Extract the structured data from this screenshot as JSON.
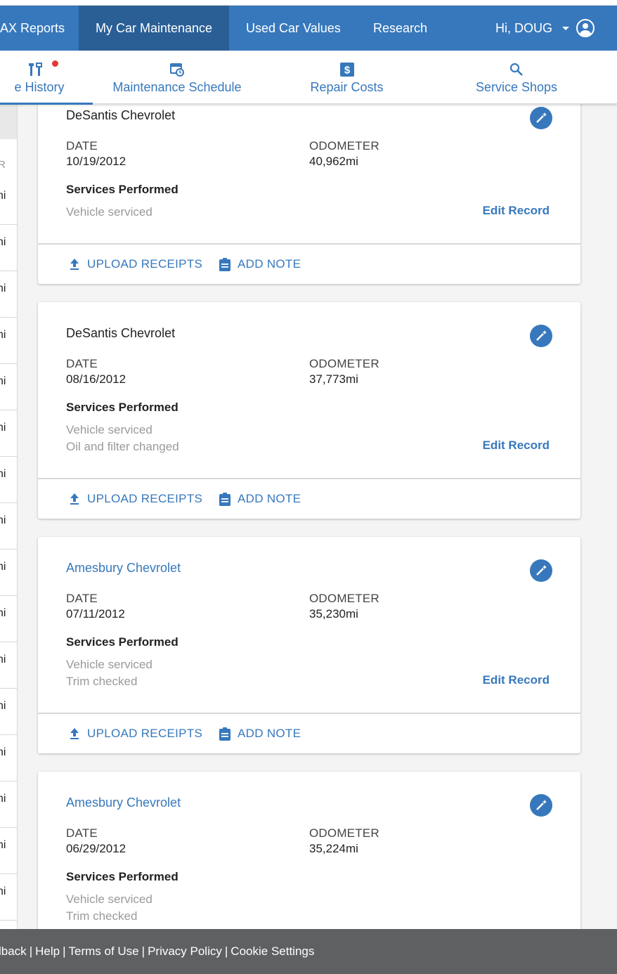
{
  "topnav": {
    "items": [
      {
        "label": "AX Reports"
      },
      {
        "label": "My Car Maintenance"
      },
      {
        "label": "Used Car Values"
      },
      {
        "label": "Research"
      }
    ],
    "user_greeting": "Hi, DOUG",
    "bg_color": "#3778bc",
    "active_color": "#2a5f96"
  },
  "subnav": {
    "tabs": [
      {
        "label": "e History",
        "icon": "tools-icon",
        "active": true,
        "badge": true
      },
      {
        "label": "Maintenance Schedule",
        "icon": "calendar-clock-icon"
      },
      {
        "label": "Repair Costs",
        "icon": "dollar-icon"
      },
      {
        "label": "Service Shops",
        "icon": "search-icon"
      }
    ]
  },
  "left_rail": {
    "column_header": "R",
    "row_text": "ni"
  },
  "cards": [
    {
      "shop": "DeSantis Chevrolet",
      "shop_is_link": false,
      "date_label": "DATE",
      "date": "10/19/2012",
      "odometer_label": "ODOMETER",
      "odometer": "40,962mi",
      "services_title": "Services Performed",
      "services": [
        "Vehicle serviced"
      ],
      "edit_label": "Edit Record",
      "upload_label": "UPLOAD RECEIPTS",
      "note_label": "ADD NOTE"
    },
    {
      "shop": "DeSantis Chevrolet",
      "shop_is_link": false,
      "date_label": "DATE",
      "date": "08/16/2012",
      "odometer_label": "ODOMETER",
      "odometer": "37,773mi",
      "services_title": "Services Performed",
      "services": [
        "Vehicle serviced",
        "Oil and filter changed"
      ],
      "edit_label": "Edit Record",
      "upload_label": "UPLOAD RECEIPTS",
      "note_label": "ADD NOTE"
    },
    {
      "shop": "Amesbury Chevrolet",
      "shop_is_link": true,
      "date_label": "DATE",
      "date": "07/11/2012",
      "odometer_label": "ODOMETER",
      "odometer": "35,230mi",
      "services_title": "Services Performed",
      "services": [
        "Vehicle serviced",
        "Trim checked"
      ],
      "edit_label": "Edit Record",
      "upload_label": "UPLOAD RECEIPTS",
      "note_label": "ADD NOTE"
    },
    {
      "shop": "Amesbury Chevrolet",
      "shop_is_link": true,
      "date_label": "DATE",
      "date": "06/29/2012",
      "odometer_label": "ODOMETER",
      "odometer": "35,224mi",
      "services_title": "Services Performed",
      "services": [
        "Vehicle serviced",
        "Trim checked"
      ]
    }
  ],
  "footer": {
    "links": [
      "lback",
      "Help",
      "Terms of Use",
      "Privacy Policy",
      "Cookie Settings"
    ]
  }
}
